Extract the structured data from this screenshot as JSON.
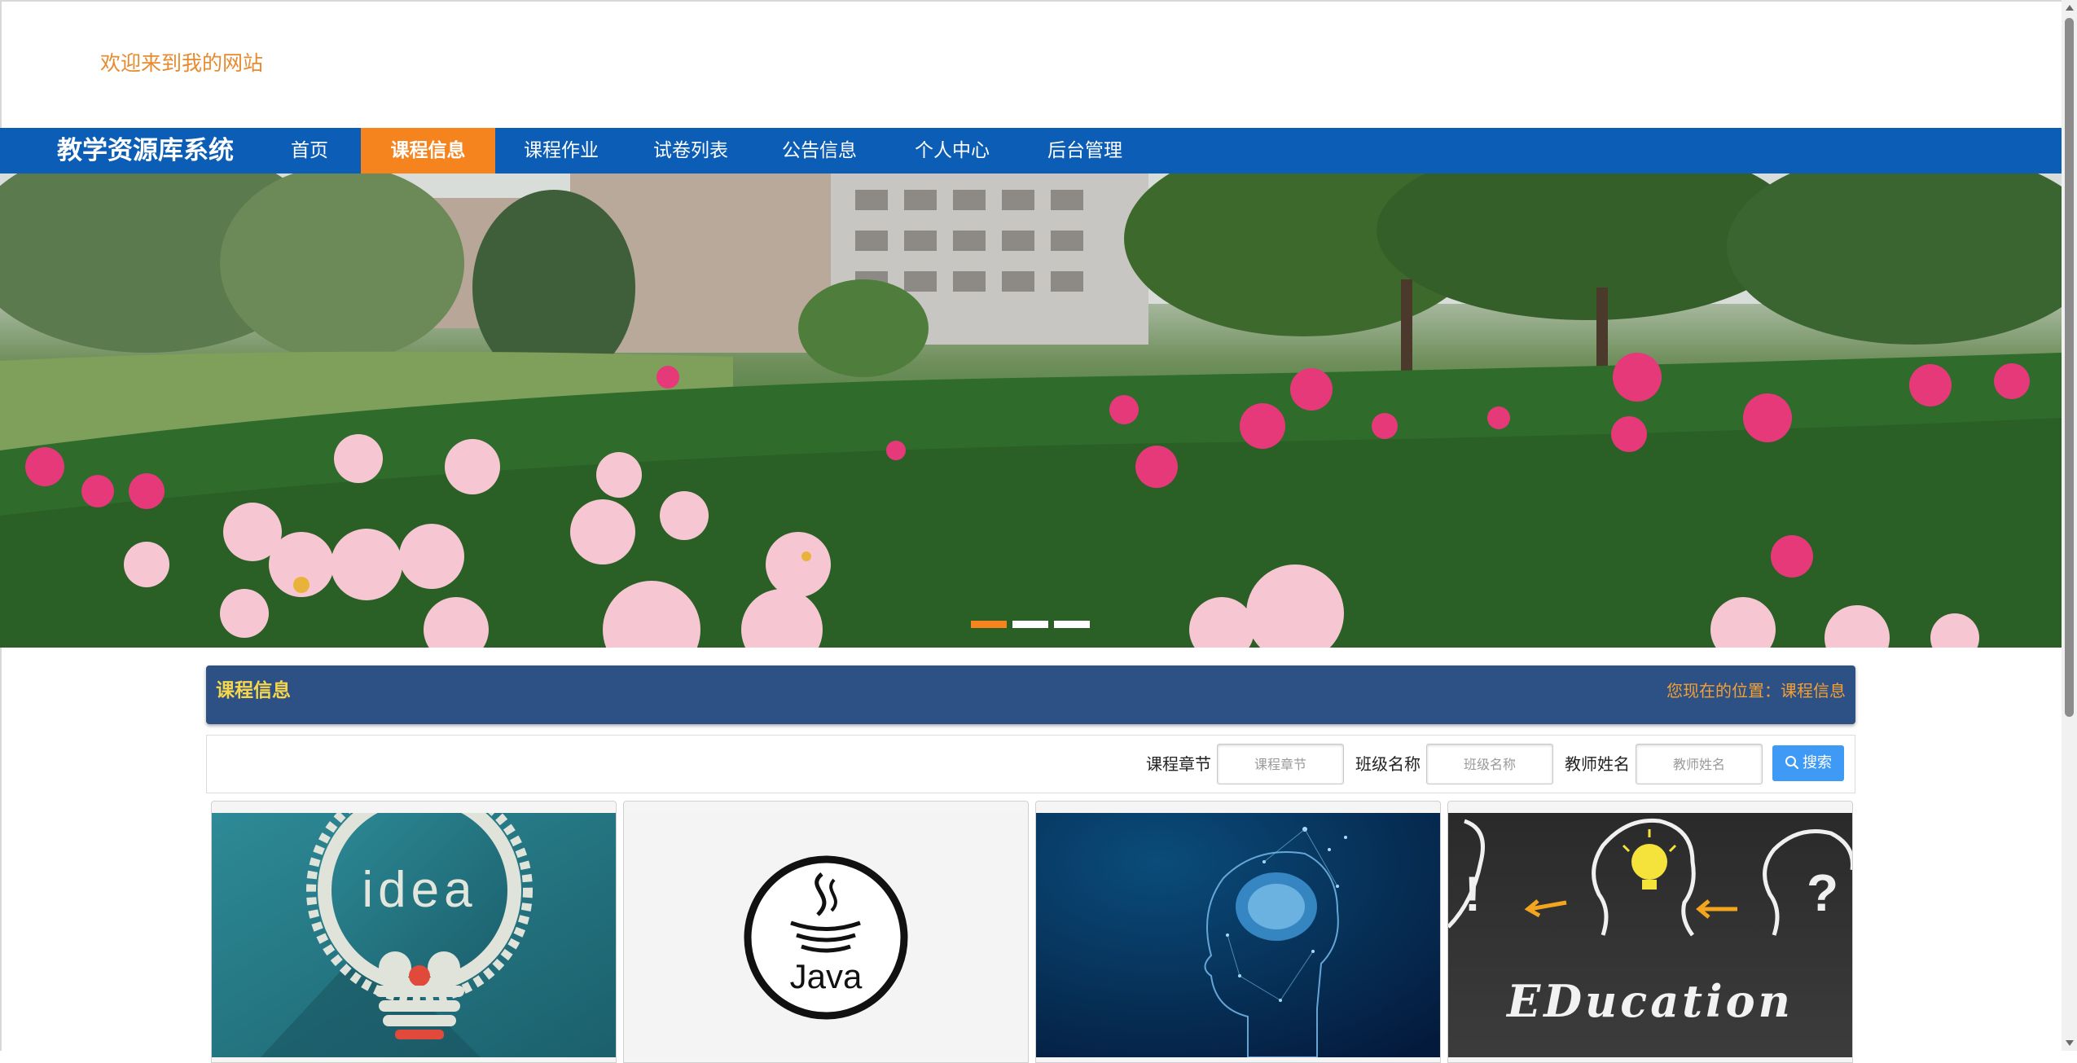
{
  "header": {
    "welcome_text": "欢迎来到我的网站"
  },
  "nav": {
    "brand": "教学资源库系统",
    "items": [
      {
        "label": "首页",
        "active": false
      },
      {
        "label": "课程信息",
        "active": true
      },
      {
        "label": "课程作业",
        "active": false
      },
      {
        "label": "试卷列表",
        "active": false
      },
      {
        "label": "公告信息",
        "active": false
      },
      {
        "label": "个人中心",
        "active": false
      },
      {
        "label": "后台管理",
        "active": false
      }
    ],
    "accent_color": "#f5841f",
    "bar_color": "#0c5db6"
  },
  "banner": {
    "slide_count": 3,
    "active_slide": 1
  },
  "section": {
    "title": "课程信息",
    "location": "您现在的位置：课程信息"
  },
  "search": {
    "fields": [
      {
        "label": "课程章节",
        "placeholder": "课程章节",
        "value": ""
      },
      {
        "label": "班级名称",
        "placeholder": "班级名称",
        "value": ""
      },
      {
        "label": "教师姓名",
        "placeholder": "教师姓名",
        "value": ""
      }
    ],
    "button_label": "搜索",
    "button_icon": "search-icon"
  },
  "courses": {
    "cards": [
      {
        "image": "idea-lightbulb-gear"
      },
      {
        "image": "java-logo"
      },
      {
        "image": "digital-brain-head"
      },
      {
        "image": "education-chalkboard"
      }
    ],
    "image_texts": {
      "idea": "idea",
      "java": "Java",
      "education": "EDucation"
    }
  }
}
